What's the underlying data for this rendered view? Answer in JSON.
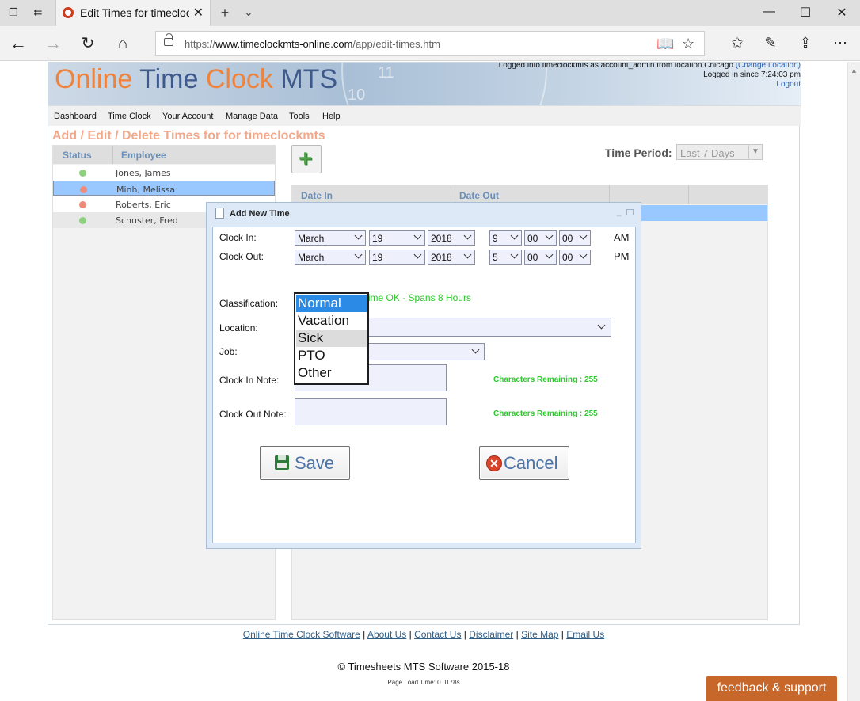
{
  "browser": {
    "tab_title": "Edit Times for timeclock",
    "url_prefix": "https://",
    "url_host": "www.timeclockmts-online.com",
    "url_path": "/app/edit-times.htm"
  },
  "header": {
    "logo": {
      "online": "Online",
      "time": "Time",
      "clock": "Clock",
      "mts": "MTS"
    },
    "clock_numerals": {
      "eleven": "11",
      "ten": "10"
    },
    "user_line": "Logged into timeclockmts as account_admin from location Chicago",
    "change_location": "(Change Location)",
    "logged_since": "Logged in since 7:24:03 pm",
    "logout": "Logout"
  },
  "menu": [
    "Dashboard",
    "Time Clock",
    "Your Account",
    "Manage Data",
    "Tools",
    "Help"
  ],
  "page_title": "Add / Edit / Delete Times for for timeclockmts",
  "employees": {
    "headers": {
      "status": "Status",
      "employee": "Employee"
    },
    "rows": [
      {
        "name": "Jones, James",
        "status": "green"
      },
      {
        "name": "Minh, Melissa",
        "status": "red"
      },
      {
        "name": "Roberts, Eric",
        "status": "red"
      },
      {
        "name": "Schuster, Fred",
        "status": "green"
      }
    ]
  },
  "time_period": {
    "label": "Time Period:",
    "value": "Last 7 Days"
  },
  "times_table": {
    "headers": {
      "date_in": "Date In",
      "date_out": "Date Out"
    }
  },
  "dialog": {
    "title": "Add New Time",
    "clock_in": {
      "label": "Clock In:",
      "month": "March",
      "day": "19",
      "year": "2018",
      "hour": "9",
      "minute": "00",
      "second": "00",
      "ampm": "AM"
    },
    "clock_out": {
      "label": "Clock Out:",
      "month": "March",
      "day": "19",
      "year": "2018",
      "hour": "5",
      "minute": "00",
      "second": "00",
      "ampm": "PM"
    },
    "status": "Time OK - Spans 8 Hours",
    "classification_label": "Classification:",
    "location_label": "Location:",
    "job_label": "Job:",
    "clock_in_note_label": "Clock In Note:",
    "clock_out_note_label": "Clock Out Note:",
    "chars_remaining_in": "Characters Remaining : 255",
    "chars_remaining_out": "Characters Remaining : 255",
    "save_label": "Save",
    "cancel_label": "Cancel",
    "classification_options": [
      "Normal",
      "Vacation",
      "Sick",
      "PTO",
      "Other"
    ]
  },
  "footer": {
    "links": [
      "Online Time Clock Software",
      "About Us",
      "Contact Us",
      "Disclaimer",
      "Site Map",
      "Email Us"
    ],
    "copyright": "© Timesheets MTS Software 2015-18",
    "load_time": "Page Load Time: 0.0178s"
  },
  "feedback_label": "feedback & support",
  "colors": {
    "selected_row": "#99c7ff",
    "ok_green": "#2fc82f",
    "logo_orange": "#f0833c",
    "logo_blue": "#3e5a8c",
    "feedback": "#c8672a"
  }
}
